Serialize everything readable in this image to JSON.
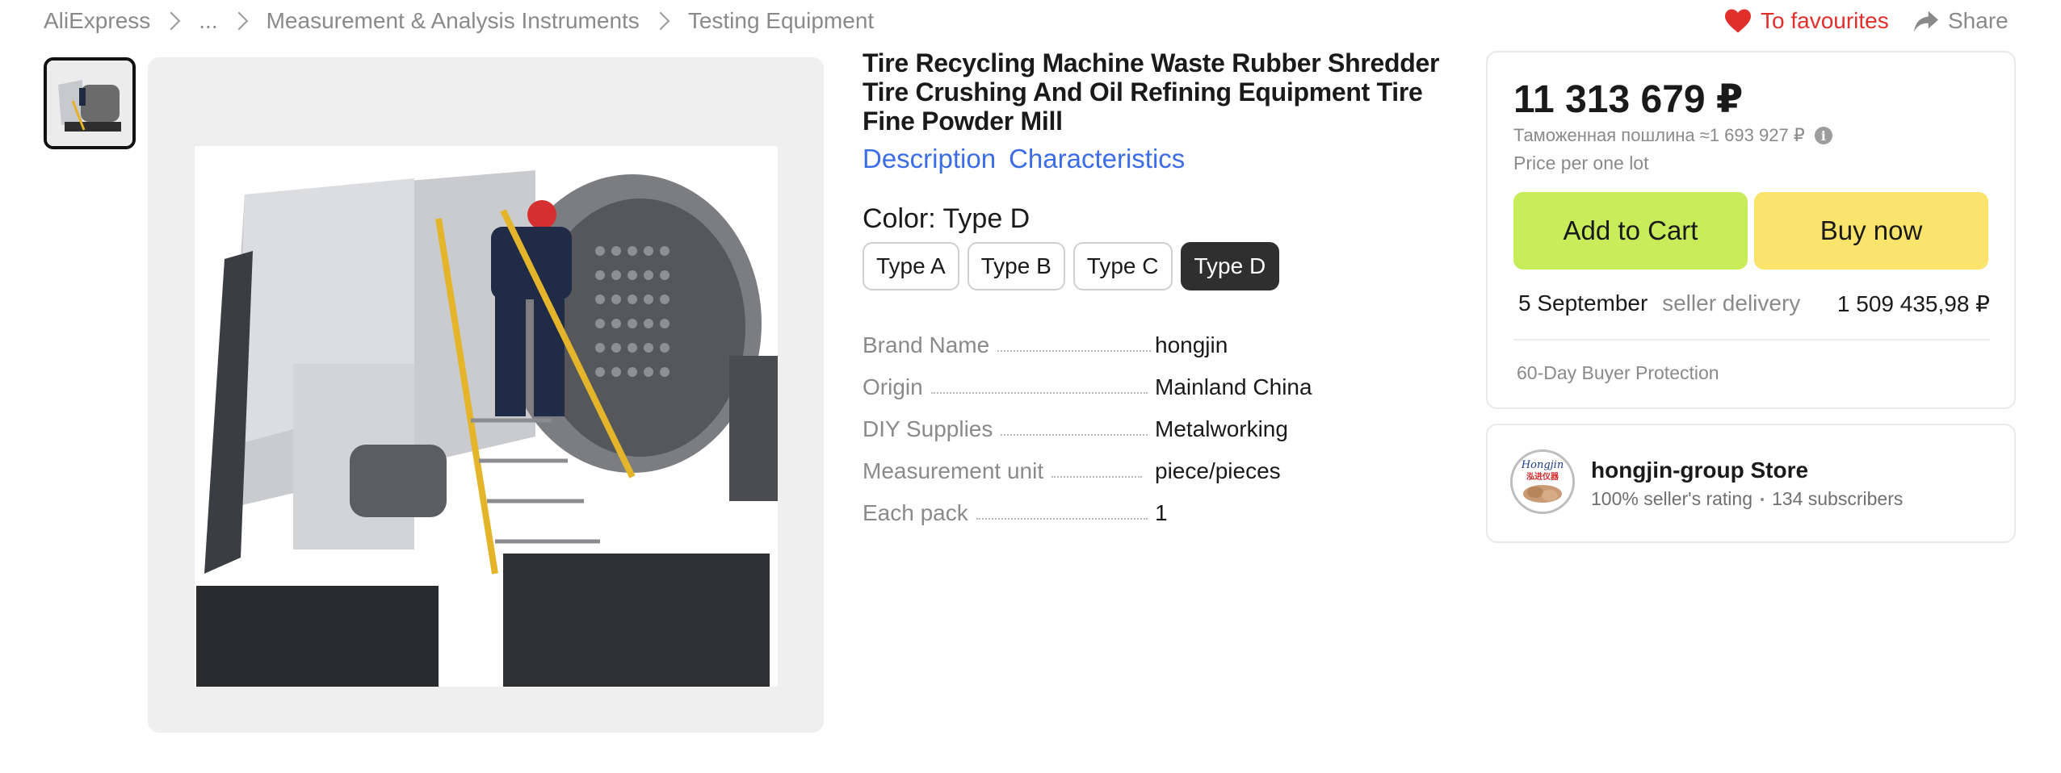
{
  "breadcrumb": {
    "items": [
      "AliExpress",
      "...",
      "Measurement & Analysis Instruments",
      "Testing Equipment"
    ]
  },
  "header_actions": {
    "favourites": "To favourites",
    "share": "Share",
    "favourites_color": "#e1302b"
  },
  "product": {
    "title": "Tire Recycling Machine Waste Rubber Shredder Tire Crushing And Oil Refining Equipment Tire Fine Powder Mill",
    "tabs": [
      "Description",
      "Characteristics"
    ],
    "color_label": "Color: Type D",
    "variants": [
      "Type A",
      "Type B",
      "Type C",
      "Type D"
    ],
    "selected_variant": "Type D",
    "specs": [
      {
        "key": "Brand Name",
        "value": "hongjin"
      },
      {
        "key": "Origin",
        "value": "Mainland China"
      },
      {
        "key": "DIY Supplies",
        "value": "Metalworking"
      },
      {
        "key": "Measurement unit",
        "value": "piece/pieces"
      },
      {
        "key": "Each pack",
        "value": "1"
      }
    ]
  },
  "price_card": {
    "price": "11 313 679 ₽",
    "duty": "Таможенная пошлина ≈1 693 927 ₽",
    "lot_note": "Price per one lot",
    "add_to_cart": "Add to Cart",
    "buy_now": "Buy now",
    "delivery_date": "5 September",
    "delivery_type": "seller delivery",
    "delivery_cost": "1 509 435,98 ₽",
    "protection": "60-Day Buyer Protection",
    "cart_color": "#c8ec5a",
    "buy_color": "#fae46b"
  },
  "store": {
    "name": "hongjin-group Store",
    "rating": "100% seller's rating",
    "subscribers": "134 subscribers",
    "logo_text": "Hongjin",
    "logo_subtext": "泓进仪器"
  }
}
